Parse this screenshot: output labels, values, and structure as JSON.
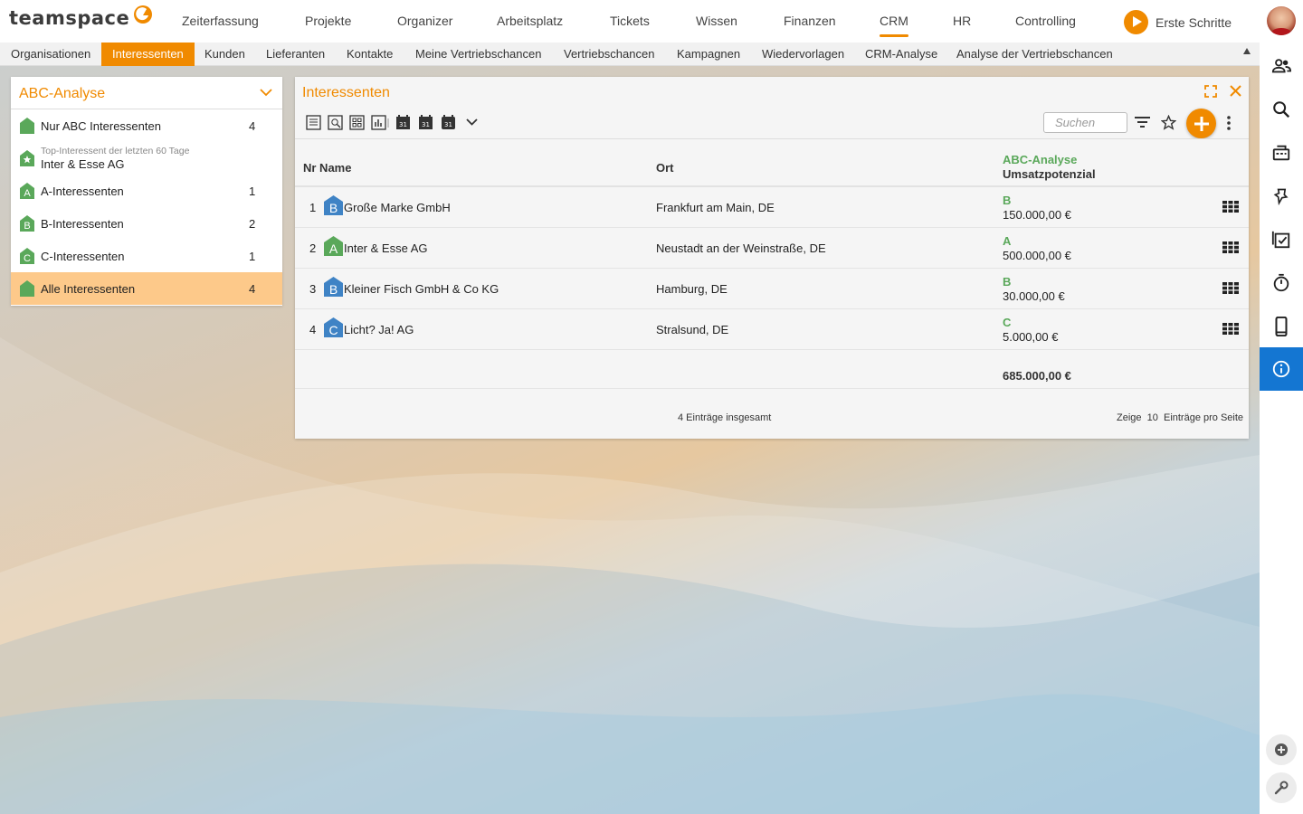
{
  "app": {
    "logo": "teamspace",
    "colors": {
      "accent": "#f08a00",
      "green": "#5aa85a",
      "blue": "#3f83c5",
      "active_blue": "#1476d2"
    }
  },
  "topnav": {
    "items": [
      "Zeiterfassung",
      "Projekte",
      "Organizer",
      "Arbeitsplatz",
      "Tickets",
      "Wissen",
      "Finanzen",
      "CRM",
      "HR",
      "Controlling"
    ],
    "active": "CRM",
    "erste_schritte": "Erste Schritte"
  },
  "subnav": {
    "items": [
      "Organisationen",
      "Interessenten",
      "Kunden",
      "Lieferanten",
      "Kontakte",
      "Meine Vertriebschancen",
      "Vertriebschancen",
      "Kampagnen",
      "Wiedervorlagen",
      "CRM-Analyse",
      "Analyse der Vertriebschancen"
    ],
    "active": "Interessenten"
  },
  "rightbar": {
    "icons": [
      "people-icon",
      "search-icon",
      "inbox-icon",
      "pin-icon",
      "tasks-icon",
      "timer-icon",
      "mobile-icon",
      "info-icon"
    ],
    "bottom": [
      "add-circle-icon",
      "wrench-icon"
    ]
  },
  "left_panel": {
    "title": "ABC-Analyse",
    "items": [
      {
        "label": "Nur ABC Interessenten",
        "count": "4",
        "icon": "house-icon",
        "letter": ""
      },
      {
        "sublabel": "Top-Interessent der letzten 60 Tage",
        "label": "Inter & Esse AG",
        "count": "",
        "icon": "star-house-icon",
        "letter": ""
      },
      {
        "label": "A-Interessenten",
        "count": "1",
        "icon": "house-a-icon",
        "letter": "A"
      },
      {
        "label": "B-Interessenten",
        "count": "2",
        "icon": "house-b-icon",
        "letter": "B"
      },
      {
        "label": "C-Interessenten",
        "count": "1",
        "icon": "house-c-icon",
        "letter": "C"
      },
      {
        "label": "Alle Interessenten",
        "count": "4",
        "icon": "house-icon",
        "letter": ""
      }
    ],
    "selected_index": 5
  },
  "main_panel": {
    "title": "Interessenten",
    "search_placeholder": "Suchen",
    "columns": {
      "nr_name": "Nr Name",
      "ort": "Ort",
      "abc_header": "ABC-Analyse",
      "umsatz_header": "Umsatzpotenzial"
    },
    "rows": [
      {
        "nr": "1",
        "grade": "B",
        "name": "Große Marke GmbH",
        "ort": "Frankfurt am Main, DE",
        "amount": "150.000,00 €"
      },
      {
        "nr": "2",
        "grade": "A",
        "name": "Inter & Esse AG",
        "ort": "Neustadt an der Weinstraße, DE",
        "amount": "500.000,00 €"
      },
      {
        "nr": "3",
        "grade": "B",
        "name": "Kleiner Fisch GmbH & Co KG",
        "ort": "Hamburg, DE",
        "amount": "30.000,00 €"
      },
      {
        "nr": "4",
        "grade": "C",
        "name": "Licht? Ja! AG",
        "ort": "Stralsund, DE",
        "amount": "5.000,00 €"
      }
    ],
    "total": "685.000,00 €",
    "footer_count": "4 Einträge insgesamt",
    "footer_per_page": "Zeige  10  Einträge pro Seite"
  }
}
